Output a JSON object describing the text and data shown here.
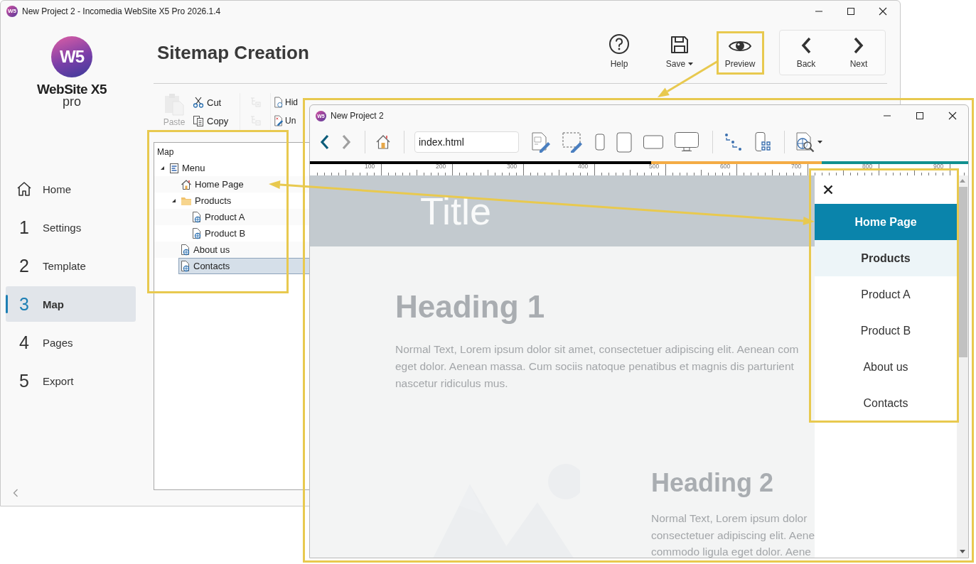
{
  "main_window": {
    "icon_text": "W5",
    "title": "New Project 2 - Incomedia WebSite X5 Pro 2026.1.4",
    "logo": {
      "mark": "W5",
      "name": "WebSite X5",
      "edition": "pro"
    },
    "nav": [
      {
        "kind": "home",
        "label": "Home",
        "selected": false
      },
      {
        "kind": "step",
        "number": "1",
        "label": "Settings",
        "selected": false
      },
      {
        "kind": "step",
        "number": "2",
        "label": "Template",
        "selected": false
      },
      {
        "kind": "step",
        "number": "3",
        "label": "Map",
        "selected": true
      },
      {
        "kind": "step",
        "number": "4",
        "label": "Pages",
        "selected": false
      },
      {
        "kind": "step",
        "number": "5",
        "label": "Export",
        "selected": false
      }
    ],
    "page_title": "Sitemap Creation",
    "toolbar": [
      {
        "kind": "help",
        "label": "Help",
        "dropdown": false
      },
      {
        "kind": "save",
        "label": "Save",
        "dropdown": true
      },
      {
        "kind": "preview",
        "label": "Preview",
        "dropdown": false
      }
    ],
    "wizard": [
      {
        "kind": "back",
        "label": "Back"
      },
      {
        "kind": "next",
        "label": "Next"
      }
    ],
    "ribbon": [
      {
        "kind": "paste",
        "label": "Paste",
        "disabled": true
      },
      {
        "kind": "cut",
        "label": "Cut",
        "disabled": false
      },
      {
        "kind": "copy",
        "label": "Copy",
        "disabled": false
      },
      {
        "kind": "add-level",
        "disabled": true
      },
      {
        "kind": "remove-level",
        "disabled": true
      },
      {
        "kind": "hide",
        "label": "Hid",
        "disabled": false
      },
      {
        "kind": "unhide",
        "label": "Un",
        "disabled": false
      }
    ],
    "sitemap": {
      "title": "Map",
      "tree": [
        {
          "kind": "menu",
          "label": "Menu",
          "expanded": true,
          "selected": false,
          "children": [
            {
              "kind": "home",
              "label": "Home Page",
              "selected": false
            },
            {
              "kind": "folder",
              "label": "Products",
              "expanded": true,
              "selected": false,
              "children": [
                {
                  "kind": "page",
                  "label": "Product A",
                  "selected": false
                },
                {
                  "kind": "page",
                  "label": "Product B",
                  "selected": false
                }
              ]
            },
            {
              "kind": "page",
              "label": "About us",
              "selected": false
            },
            {
              "kind": "page",
              "label": "Contacts",
              "selected": true
            }
          ]
        }
      ]
    }
  },
  "preview_window": {
    "icon_text": "W5",
    "title": "New Project 2",
    "nav": [
      {
        "kind": "back",
        "disabled": false
      },
      {
        "kind": "forward",
        "disabled": true
      }
    ],
    "address": "index.html",
    "breakpoints": [
      {
        "color": "#000000"
      },
      {
        "color": "#f4ac45"
      },
      {
        "color": "#11908f"
      }
    ],
    "ruler": [
      "100",
      "200",
      "300",
      "400",
      "500",
      "600",
      "700",
      "800",
      "900"
    ],
    "page": {
      "title": "Title",
      "sections": [
        {
          "kind": "text",
          "heading": "Heading 1",
          "lines": [
            "Normal Text, Lorem ipsum dolor sit amet, consectetuer adipiscing elit. Aenean com",
            "eget dolor. Aenean massa. Cum sociis natoque penatibus et magnis dis parturient",
            "nascetur ridiculus mus."
          ]
        },
        {
          "kind": "picture",
          "heading": "Heading 2",
          "lines": [
            "Normal Text, Lorem ipsum dolor",
            "consectetuer adipiscing elit. Aene",
            "commodo ligula eget dolor. Aene"
          ]
        }
      ]
    },
    "menu": {
      "items": [
        {
          "kind": "page",
          "label": "Home Page",
          "selected": true
        },
        {
          "kind": "folder",
          "label": "Products",
          "selected": false
        },
        {
          "kind": "page",
          "label": "Product A",
          "selected": false
        },
        {
          "kind": "page",
          "label": "Product B",
          "selected": false
        },
        {
          "kind": "page",
          "label": "About us",
          "selected": false
        },
        {
          "kind": "page",
          "label": "Contacts",
          "selected": false
        }
      ]
    }
  }
}
